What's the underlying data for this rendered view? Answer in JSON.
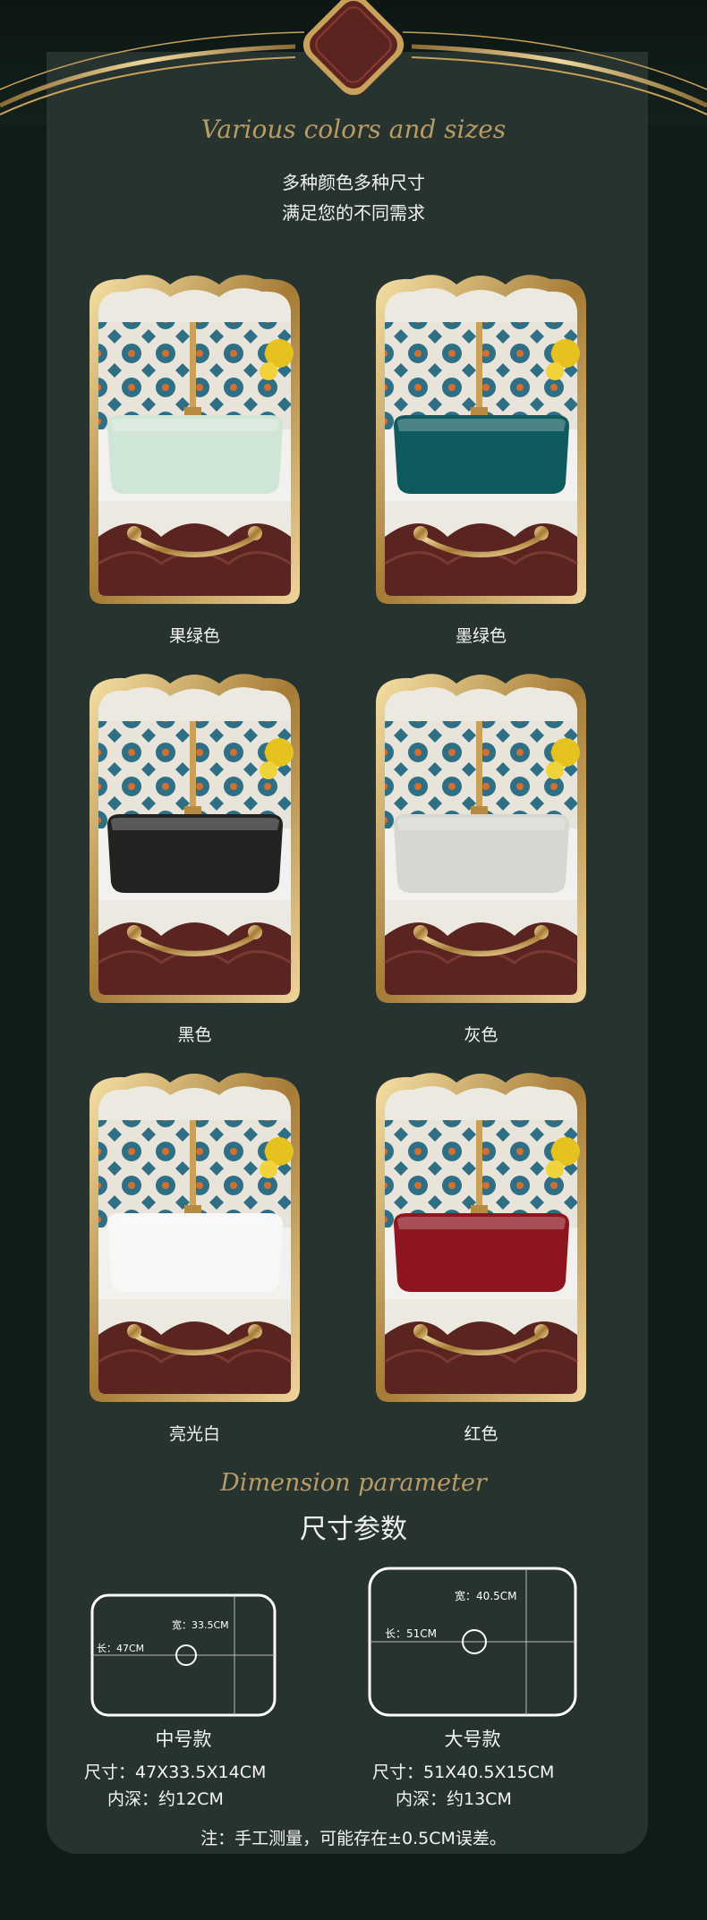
{
  "header": {
    "script_title": "Various colors and sizes",
    "line1": "多种颜色多种尺寸",
    "line2": "满足您的不同需求"
  },
  "swatches": [
    {
      "label": "果绿色",
      "color": "#cfe5d6"
    },
    {
      "label": "墨绿色",
      "color": "#0f5a5e"
    },
    {
      "label": "黑色",
      "color": "#222222"
    },
    {
      "label": "灰色",
      "color": "#d6d6d2"
    },
    {
      "label": "亮光白",
      "color": "#f7f7f7"
    },
    {
      "label": "红色",
      "color": "#8c1520"
    }
  ],
  "dimension": {
    "script_title": "Dimension parameter",
    "title": "尺寸参数",
    "medium": {
      "name": "中号款",
      "width_label": "宽：33.5CM",
      "length_label": "长：47CM",
      "size": "尺寸：47X33.5X14CM",
      "depth": "内深：约12CM"
    },
    "large": {
      "name": "大号款",
      "width_label": "宽：40.5CM",
      "length_label": "长：51CM",
      "size": "尺寸：51X40.5X15CM",
      "depth": "内深：约13CM"
    }
  },
  "note": "注：手工测量，可能存在±0.5CM误差。",
  "colors": {
    "gold": "#c9a15a",
    "panel": "#26332f",
    "background": "#101c17",
    "medallion": "#5a2420"
  }
}
